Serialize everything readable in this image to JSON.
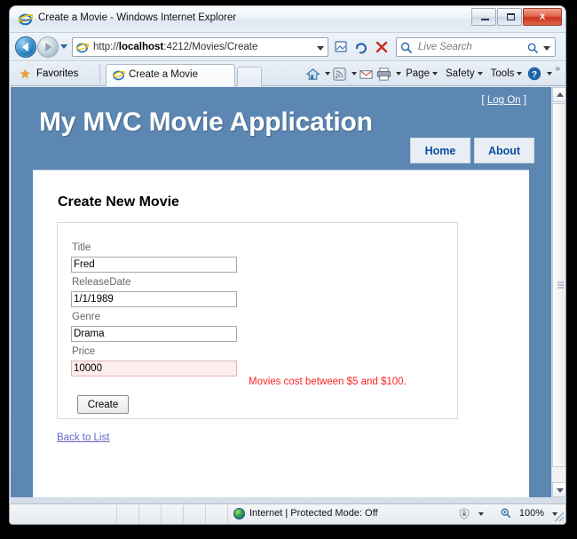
{
  "window": {
    "title": "Create a Movie - Windows Internet Explorer",
    "minimize_label": "Minimize",
    "maximize_label": "Maximize",
    "close_label": "x"
  },
  "navigation": {
    "back_label": "Back",
    "forward_label": "Forward",
    "history_label": "Recent Pages",
    "address": {
      "protocol_prefix": "http://",
      "host": "localhost",
      "path": ":4212/Movies/Create",
      "full": "http://localhost:4212/Movies/Create"
    },
    "compat_label": "Compatibility View",
    "refresh_label": "Refresh",
    "stop_label": "Stop",
    "search_placeholder": "Live Search"
  },
  "toolbar": {
    "favorites_label": "Favorites",
    "tab_label": "Create a Movie",
    "new_tab_label": "New Tab",
    "commands": [
      {
        "label": "Page",
        "caret": true
      },
      {
        "label": "Safety",
        "caret": true
      },
      {
        "label": "Tools",
        "caret": true
      }
    ],
    "overflow_label": "»"
  },
  "page": {
    "logon_open": "[",
    "logon_label": "Log On",
    "logon_close": "]",
    "site_title": "My MVC Movie Application",
    "menu": [
      {
        "label": "Home"
      },
      {
        "label": "About"
      }
    ],
    "heading": "Create New Movie",
    "fields": [
      {
        "label": "Title",
        "value": "Fred",
        "error": false
      },
      {
        "label": "ReleaseDate",
        "value": "1/1/1989",
        "error": false
      },
      {
        "label": "Genre",
        "value": "Drama",
        "error": false
      },
      {
        "label": "Price",
        "value": "10000",
        "error": true
      }
    ],
    "validation_message": "Movies cost between $5 and $100.",
    "submit_label": "Create",
    "back_link_label": "Back to List"
  },
  "statusbar": {
    "zone_text": "Internet | Protected Mode: Off",
    "zoom_level": "100%"
  },
  "colors": {
    "page_blue": "#5c87b2",
    "menu_link": "#0a4d9e",
    "error_red": "#ff2222",
    "error_field_bg": "#fdeded",
    "link_purple": "#6666cc"
  }
}
